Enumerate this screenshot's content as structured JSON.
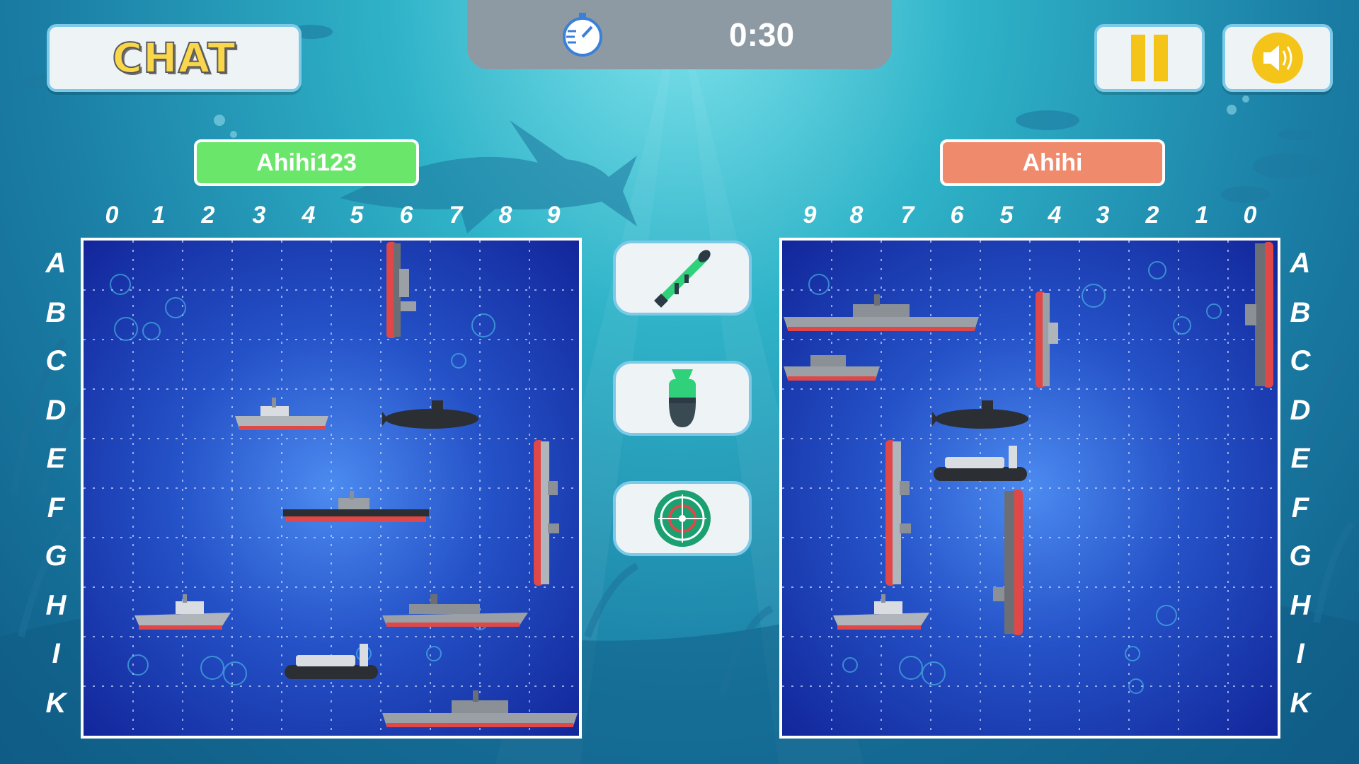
{
  "chat_button": {
    "label": "CHAT"
  },
  "timer": {
    "value": "0:30",
    "icon": "stopwatch-icon"
  },
  "pause_button": {
    "icon": "pause-icon"
  },
  "sound_button": {
    "icon": "speaker-icon"
  },
  "players": {
    "left": {
      "name": "Ahihi123",
      "color": "#6ae76a"
    },
    "right": {
      "name": "Ahihi",
      "color": "#f08a6c"
    }
  },
  "board_left": {
    "columns": [
      "0",
      "1",
      "2",
      "3",
      "4",
      "5",
      "6",
      "7",
      "8",
      "9"
    ],
    "rows": [
      "A",
      "B",
      "C",
      "D",
      "E",
      "F",
      "G",
      "H",
      "I",
      "K"
    ]
  },
  "board_right": {
    "columns": [
      "9",
      "8",
      "7",
      "6",
      "5",
      "4",
      "3",
      "2",
      "1",
      "0"
    ],
    "rows": [
      "A",
      "B",
      "C",
      "D",
      "E",
      "F",
      "G",
      "H",
      "I",
      "K"
    ]
  },
  "weapons": [
    {
      "name": "rocket-launcher",
      "icon": "bazooka-icon"
    },
    {
      "name": "bomb",
      "icon": "bomb-icon"
    },
    {
      "name": "radar",
      "icon": "radar-icon"
    }
  ],
  "colors": {
    "accent": "#7cc9e8",
    "ship_red": "#e04848",
    "board_blue": "#2552c8"
  }
}
